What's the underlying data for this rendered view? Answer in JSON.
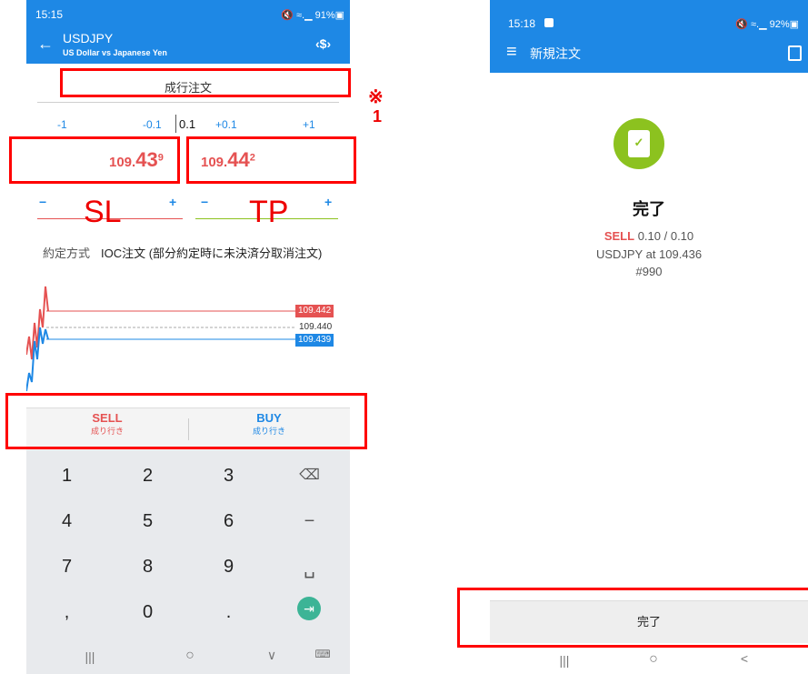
{
  "left": {
    "status": {
      "time": "15:15",
      "icons": "🔇 ≈.▁ 91%▣"
    },
    "header": {
      "back": "←",
      "symbol": "USDJPY",
      "subtitle": "US Dollar vs Japanese Yen",
      "action": "‹$›"
    },
    "order_type": "成行注文",
    "volume_steps": {
      "minus1": "-1",
      "minus01": "-0.1",
      "volume": "0.1",
      "plus01": "+0.1",
      "plus1": "+1"
    },
    "sell_price": {
      "prefix": "109.",
      "big": "43",
      "sup": "9"
    },
    "buy_price": {
      "prefix": "109.",
      "big": "44",
      "sup": "2"
    },
    "sl": {
      "minus": "−",
      "label": "SL",
      "plus": "+"
    },
    "tp": {
      "minus": "−",
      "label": "TP",
      "plus": "+"
    },
    "execution": {
      "label": "約定方式",
      "value": "IOC注文 (部分約定時に未決済分取消注文)"
    },
    "chart_tags": {
      "ask": "109.442",
      "mid": "109.440",
      "bid": "109.439"
    },
    "sell_button": {
      "label": "SELL",
      "sub": "成り行き"
    },
    "buy_button": {
      "label": "BUY",
      "sub": "成り行き"
    },
    "keypad": [
      "1",
      "2",
      "3",
      "4",
      "5",
      "6",
      "7",
      "8",
      "9",
      ",",
      "0",
      "."
    ],
    "nav": {
      "recent": "|||",
      "home": "○",
      "back": "∨",
      "kbd": "⌨"
    },
    "colors": {
      "header": "#1e88e5",
      "sell": "#e55252",
      "buy": "#1e88e5",
      "enter": "#3cb496"
    }
  },
  "annotations": {
    "sl": "SL",
    "tp": "TP",
    "note_mark": "※",
    "note_num": "1"
  },
  "right": {
    "status": {
      "time": "15:18",
      "icons": "🔇 ≈.▁ 92%▣"
    },
    "header": {
      "menu": "≡",
      "title": "新規注文"
    },
    "result": {
      "title": "完了",
      "side": "SELL",
      "volume": "0.10 / 0.10",
      "detail": "USDJPY at 109.436",
      "ticket": "#990"
    },
    "done_button": "完了",
    "nav": {
      "recent": "|||",
      "home": "○",
      "back": "<"
    },
    "colors": {
      "success": "#8cc21f",
      "sell": "#e55252"
    }
  }
}
